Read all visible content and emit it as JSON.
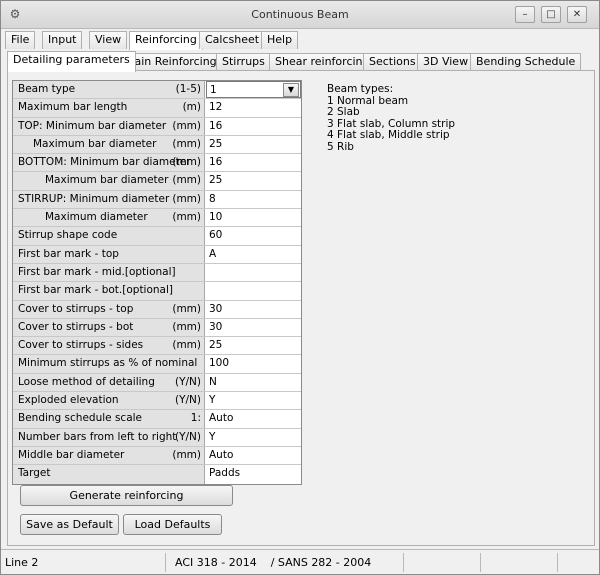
{
  "window": {
    "title": "Continuous Beam",
    "controls": {
      "minimize": "–",
      "maximize": "□",
      "close": "✕"
    }
  },
  "menu": [
    "File",
    "Input",
    "View",
    "Reinforcing",
    "Calcsheet",
    "Help"
  ],
  "tabs": [
    "Detailing parameters",
    "Main Reinforcing",
    "Stirrups",
    "Shear reinforcing",
    "Sections",
    "3D View",
    "Bending Schedule"
  ],
  "grid": [
    {
      "label": "Beam type",
      "unit": "(1-5)",
      "value": "1",
      "indent": 0
    },
    {
      "label": "Maximum bar length",
      "unit": "(m)",
      "value": "12",
      "indent": 0
    },
    {
      "label": "TOP: Minimum bar diameter",
      "unit": "(mm)",
      "value": "16",
      "indent": 0
    },
    {
      "label": "Maximum bar diameter",
      "unit": "(mm)",
      "value": "25",
      "indent": 1
    },
    {
      "label": "BOTTOM: Minimum bar diameter",
      "unit": "(mm)",
      "value": "16",
      "indent": 0
    },
    {
      "label": "Maximum bar diameter",
      "unit": "(mm)",
      "value": "25",
      "indent": 2
    },
    {
      "label": "STIRRUP: Minimum diameter",
      "unit": "(mm)",
      "value": "8",
      "indent": 0
    },
    {
      "label": "Maximum diameter",
      "unit": "(mm)",
      "value": "10",
      "indent": 2
    },
    {
      "label": "Stirrup shape code",
      "unit": "",
      "value": "60",
      "indent": 0
    },
    {
      "label": "First bar mark - top",
      "unit": "",
      "value": "A",
      "indent": 0
    },
    {
      "label": "First bar mark - mid.[optional]",
      "unit": "",
      "value": "",
      "indent": 0
    },
    {
      "label": "First bar mark - bot.[optional]",
      "unit": "",
      "value": "",
      "indent": 0
    },
    {
      "label": "Cover to stirrups - top",
      "unit": "(mm)",
      "value": "30",
      "indent": 0
    },
    {
      "label": "Cover to stirrups - bot",
      "unit": "(mm)",
      "value": "30",
      "indent": 0
    },
    {
      "label": "Cover to stirrups - sides",
      "unit": "(mm)",
      "value": "25",
      "indent": 0
    },
    {
      "label": "Minimum stirrups as % of nominal",
      "unit": "",
      "value": "100",
      "indent": 0
    },
    {
      "label": "Loose method of detailing",
      "unit": "(Y/N)",
      "value": "N",
      "indent": 0
    },
    {
      "label": "Exploded elevation",
      "unit": "(Y/N)",
      "value": "Y",
      "indent": 0
    },
    {
      "label": "Bending schedule scale",
      "unit": "1:",
      "value": "Auto",
      "indent": 0
    },
    {
      "label": "Number bars from left to right",
      "unit": "(Y/N)",
      "value": "Y",
      "indent": 0
    },
    {
      "label": "Middle bar diameter",
      "unit": "(mm)",
      "value": "Auto",
      "indent": 0
    },
    {
      "label": "Target",
      "unit": "",
      "value": "Padds",
      "indent": 0
    }
  ],
  "info": {
    "title": "Beam types:",
    "lines": [
      "1 Normal beam",
      "2 Slab",
      "3 Flat slab, Column strip",
      "4 Flat slab, Middle strip",
      "5 Rib"
    ]
  },
  "buttons": {
    "generate": "Generate reinforcing",
    "save_default": "Save as Default",
    "load_defaults": "Load Defaults"
  },
  "status": {
    "left": "Line 2",
    "codes": "ACI 318 - 2014    / SANS 282 - 2004"
  }
}
